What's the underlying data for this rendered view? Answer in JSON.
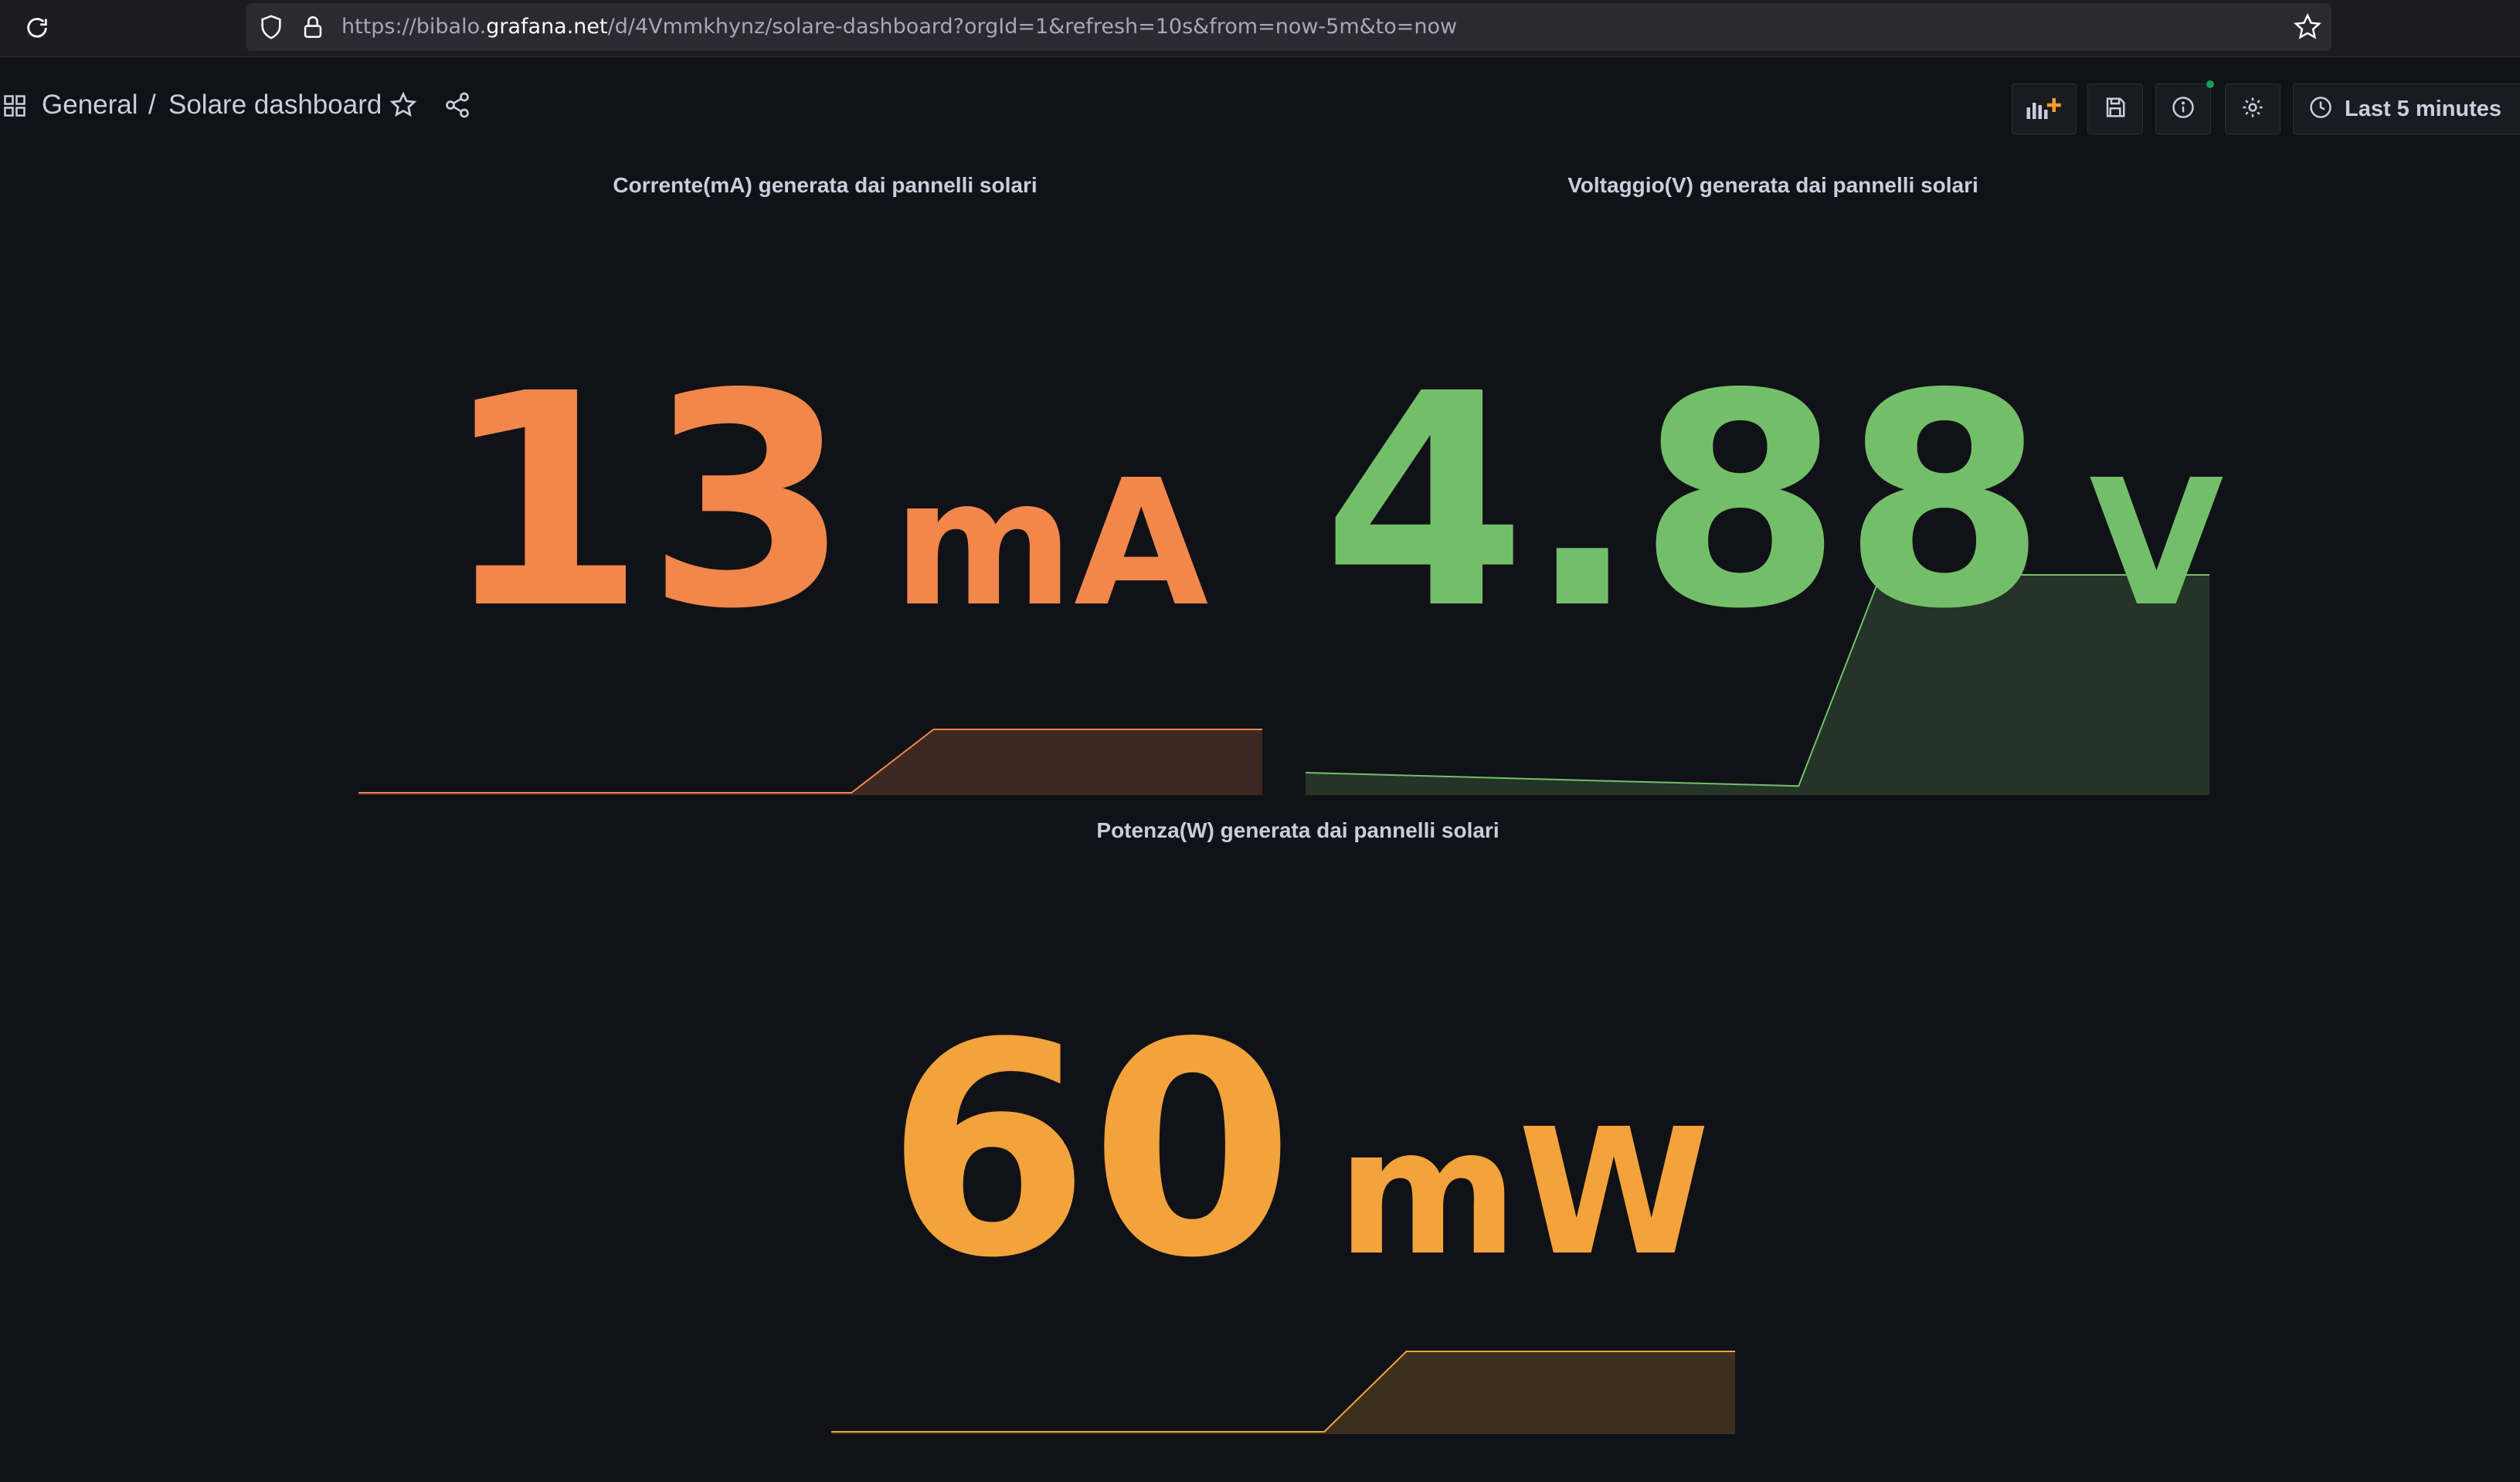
{
  "browser": {
    "url_prefix": "https://bibalo.",
    "url_host": "grafana.net",
    "url_suffix": "/d/4Vmmkhynz/solare-dashboard?orgId=1&refresh=10s&from=now-5m&to=now",
    "icons": [
      "reload-icon",
      "shield-icon",
      "lock-icon",
      "bookmark-star-icon"
    ]
  },
  "nav": {
    "folder": "General",
    "separator": "/",
    "dashboard_title": "Solare dashboard",
    "time_range": "Last 5 minutes",
    "icons": [
      "apps-grid-icon",
      "star-icon",
      "share-icon",
      "add-panel-icon",
      "save-icon",
      "info-icon",
      "gear-icon",
      "clock-icon",
      "chevron-down-icon"
    ]
  },
  "colors": {
    "background": "#111217",
    "current": "#f2874b",
    "voltage": "#73bf69",
    "power": "#f2a33c"
  },
  "panels": [
    {
      "title": "Corrente(mA) generata dai pannelli solari",
      "value": "13",
      "unit": "mA",
      "sparkline": [
        0,
        0,
        0,
        0,
        0,
        0,
        0,
        13,
        13,
        13,
        13,
        13
      ]
    },
    {
      "title": "Voltaggio(V) generata dai pannelli solari",
      "value": "4.88",
      "unit": "V",
      "sparkline": [
        0.45,
        0.4,
        0.35,
        0.3,
        0.25,
        0.2,
        0.15,
        4.88,
        4.88,
        4.88,
        4.88,
        4.88
      ]
    },
    {
      "title": "Potenza(W) generata dai pannelli solari",
      "value": "60",
      "unit": "mW",
      "sparkline": [
        0,
        0,
        0,
        0,
        0,
        0,
        0,
        60,
        60,
        60,
        60,
        60
      ]
    }
  ]
}
